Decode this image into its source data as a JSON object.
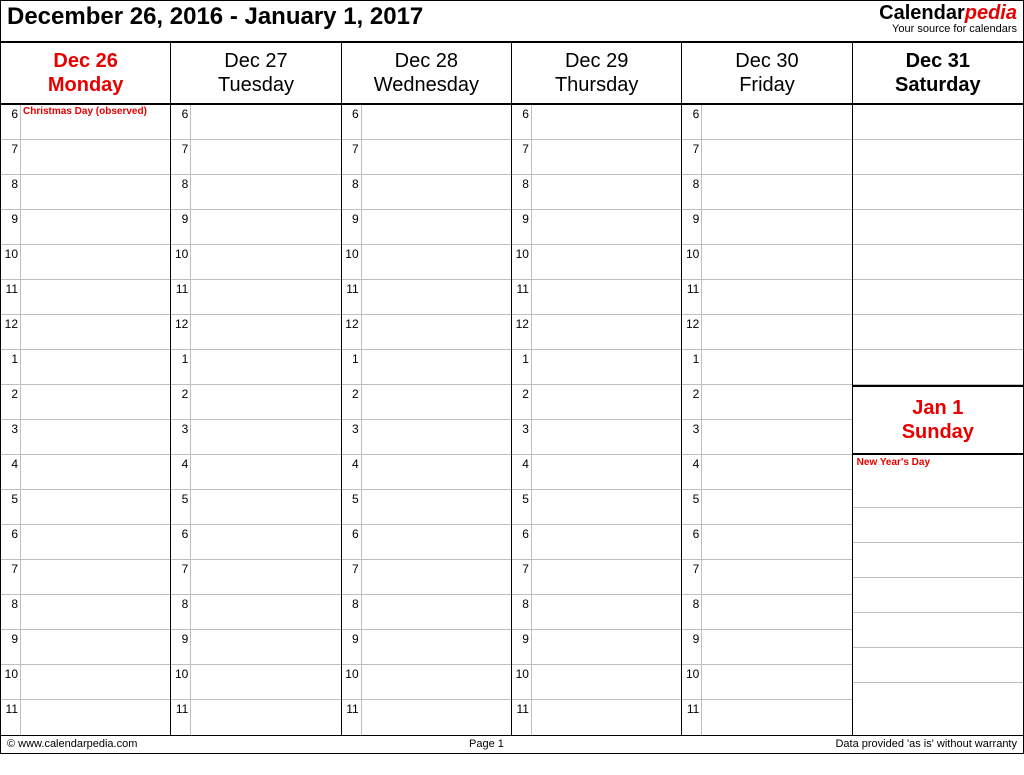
{
  "header": {
    "title": "December 26, 2016 - January 1, 2017",
    "brand_a": "Calendar",
    "brand_b": "pedia",
    "tagline": "Your source for calendars"
  },
  "days": [
    {
      "date": "Dec 26",
      "weekday": "Monday",
      "style": "red",
      "note": "Christmas Day (observed)"
    },
    {
      "date": "Dec 27",
      "weekday": "Tuesday",
      "style": "",
      "note": ""
    },
    {
      "date": "Dec 28",
      "weekday": "Wednesday",
      "style": "",
      "note": ""
    },
    {
      "date": "Dec 29",
      "weekday": "Thursday",
      "style": "",
      "note": ""
    },
    {
      "date": "Dec 30",
      "weekday": "Friday",
      "style": "",
      "note": ""
    }
  ],
  "saturday": {
    "date": "Dec 31",
    "weekday": "Saturday"
  },
  "sunday": {
    "date": "Jan 1",
    "weekday": "Sunday",
    "note": "New Year's Day"
  },
  "hours": [
    "6",
    "7",
    "8",
    "9",
    "10",
    "11",
    "12",
    "1",
    "2",
    "3",
    "4",
    "5",
    "6",
    "7",
    "8",
    "9",
    "10",
    "11"
  ],
  "footer": {
    "left": "© www.calendarpedia.com",
    "center": "Page 1",
    "right": "Data provided 'as is' without warranty"
  }
}
